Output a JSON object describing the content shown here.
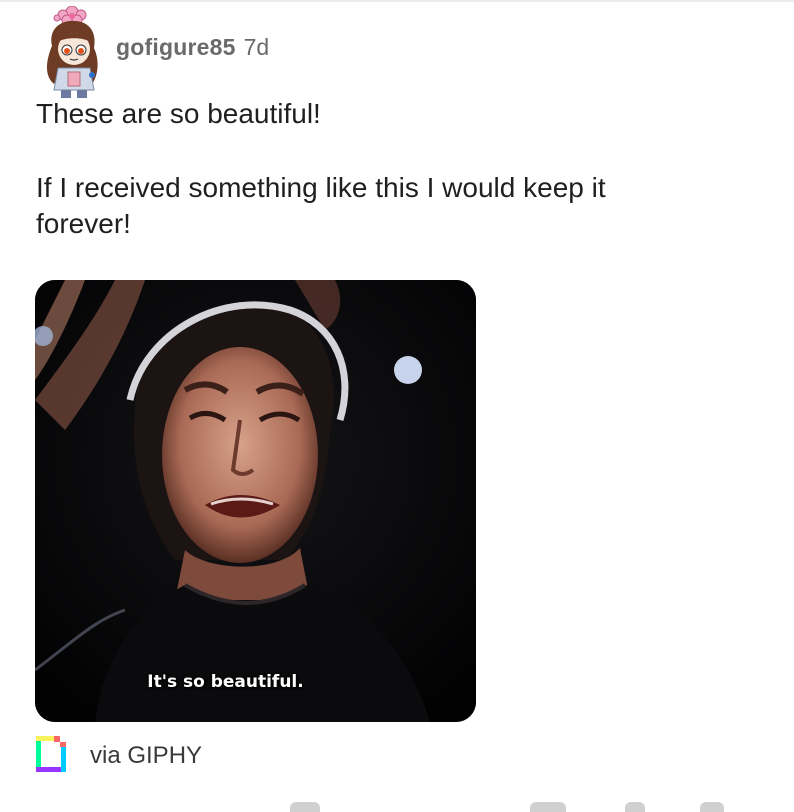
{
  "comment": {
    "username": "gofigure85",
    "timestamp": "7d",
    "lines": [
      "These are so beautiful!",
      "If I received something like this I would keep it",
      "forever!"
    ]
  },
  "gif": {
    "caption": "It's so beautiful.",
    "source_label": "via GIPHY"
  },
  "icons": {
    "avatar": "user-avatar-icon",
    "giphy": "giphy-logo-icon"
  },
  "colors": {
    "meta_text": "#6a6a6a",
    "body_text": "#1f1f1f",
    "gif_background": "#050507"
  }
}
